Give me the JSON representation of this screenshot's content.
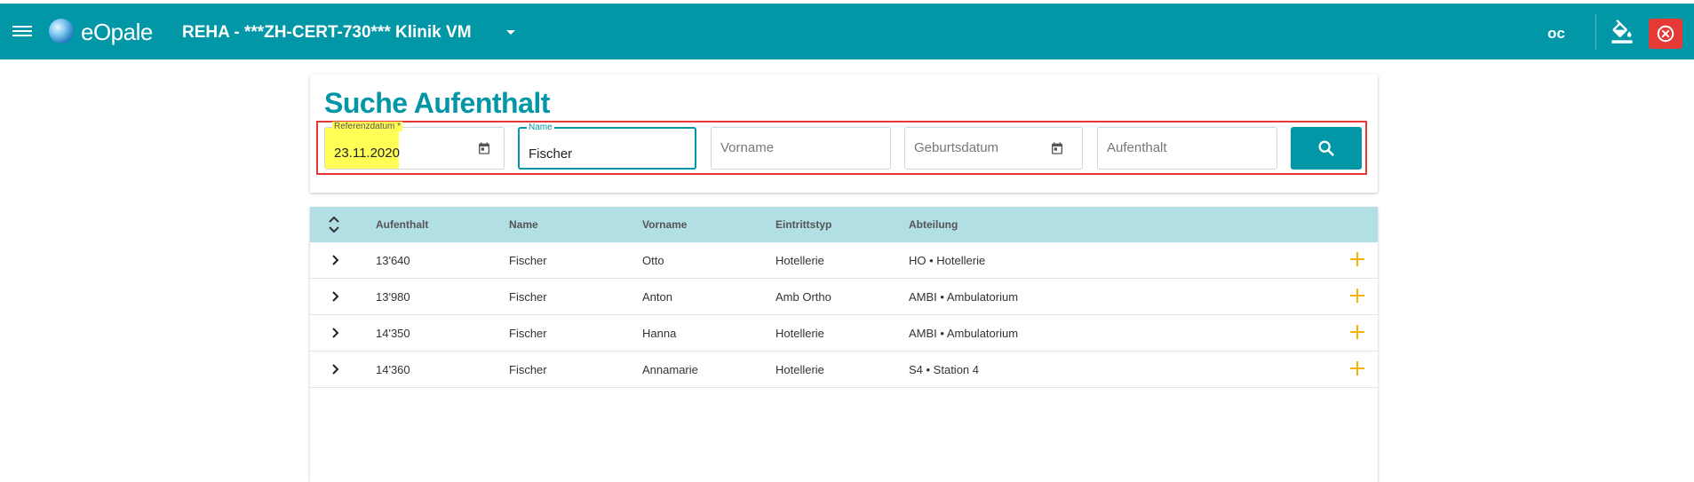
{
  "header": {
    "app_name": "eOpale",
    "tenant": "REHA - ***ZH-CERT-730*** Klinik VM",
    "user_initials": "oc",
    "icons": [
      "menu-icon",
      "globe-logo-icon",
      "chevron-down-icon",
      "paint-bucket-icon",
      "close-circle-icon"
    ],
    "colors": {
      "primary": "#0197a7",
      "danger": "#e53935"
    }
  },
  "search": {
    "title": "Suche Aufenthalt",
    "referenzdatum": {
      "label": "Referenzdatum *",
      "value": "23.11.2020"
    },
    "name": {
      "label": "Name",
      "value": "Fischer"
    },
    "vorname": {
      "placeholder": "Vorname"
    },
    "geburtsdatum": {
      "placeholder": "Geburtsdatum"
    },
    "aufenthalt": {
      "placeholder": "Aufenthalt"
    }
  },
  "table": {
    "columns": [
      "Aufenthalt",
      "Name",
      "Vorname",
      "Eintrittstyp",
      "Abteilung"
    ],
    "rows": [
      {
        "aufenthalt": "13'640",
        "name": "Fischer",
        "vorname": "Otto",
        "eintrittstyp": "Hotellerie",
        "abteilung": "HO • Hotellerie"
      },
      {
        "aufenthalt": "13'980",
        "name": "Fischer",
        "vorname": "Anton",
        "eintrittstyp": "Amb Ortho",
        "abteilung": "AMBI • Ambulatorium"
      },
      {
        "aufenthalt": "14'350",
        "name": "Fischer",
        "vorname": "Hanna",
        "eintrittstyp": "Hotellerie",
        "abteilung": "AMBI • Ambulatorium"
      },
      {
        "aufenthalt": "14'360",
        "name": "Fischer",
        "vorname": "Annamarie",
        "eintrittstyp": "Hotellerie",
        "abteilung": "S4 • Station 4"
      }
    ],
    "accent_plus_color": "#f5b400"
  }
}
